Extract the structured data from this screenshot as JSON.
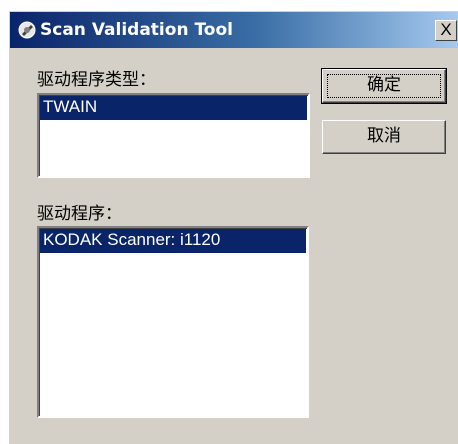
{
  "window": {
    "title": "Scan Validation Tool",
    "close_glyph": "X",
    "icon": "scanner-app-icon"
  },
  "driver_type": {
    "label": "驱动程序类型：",
    "items": [
      "TWAIN"
    ],
    "selected": "TWAIN"
  },
  "driver": {
    "label": "驱动程序：",
    "items": [
      "KODAK Scanner: i1120"
    ],
    "selected": "KODAK Scanner: i1120"
  },
  "buttons": {
    "ok_label": "确定",
    "cancel_label": "取消"
  },
  "colors": {
    "titlebar_start": "#0a246a",
    "titlebar_end": "#a6caf0",
    "selection": "#0a246a",
    "face": "#d4d0c8"
  }
}
